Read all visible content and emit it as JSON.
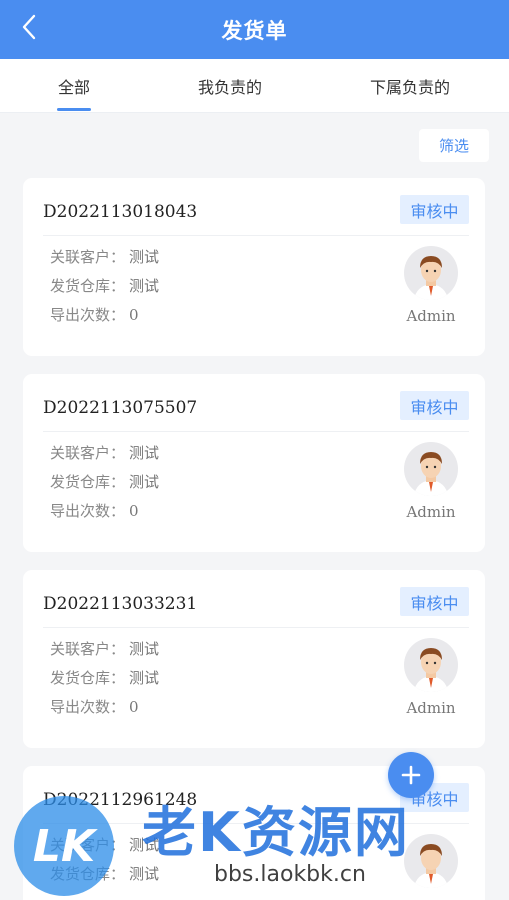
{
  "header": {
    "title": "发货单",
    "back_icon": "chevron-left-icon"
  },
  "tabs": [
    {
      "label": "全部",
      "active": true
    },
    {
      "label": "我负责的",
      "active": false
    },
    {
      "label": "下属负责的",
      "active": false
    }
  ],
  "filter": {
    "label": "筛选"
  },
  "field_labels": {
    "customer": "关联客户：",
    "warehouse": "发货仓库：",
    "exports": "导出次数："
  },
  "orders": [
    {
      "order_no": "D2022113018043",
      "status": "审核中",
      "customer": "测试",
      "warehouse": "测试",
      "export_count": "0",
      "owner": "Admin"
    },
    {
      "order_no": "D2022113075507",
      "status": "审核中",
      "customer": "测试",
      "warehouse": "测试",
      "export_count": "0",
      "owner": "Admin"
    },
    {
      "order_no": "D2022113033231",
      "status": "审核中",
      "customer": "测试",
      "warehouse": "测试",
      "export_count": "0",
      "owner": "Admin"
    },
    {
      "order_no": "D2022112961248",
      "status": "审核中",
      "customer": "测试",
      "warehouse": "测试",
      "export_count": "",
      "owner": ""
    }
  ],
  "fab": {
    "icon": "plus-icon"
  },
  "watermark": {
    "logo_text": "LK",
    "title": "老K资源网",
    "url": "bbs.laokbk.cn"
  },
  "colors": {
    "accent": "#4a8df0",
    "status_bg": "#e4efff"
  }
}
